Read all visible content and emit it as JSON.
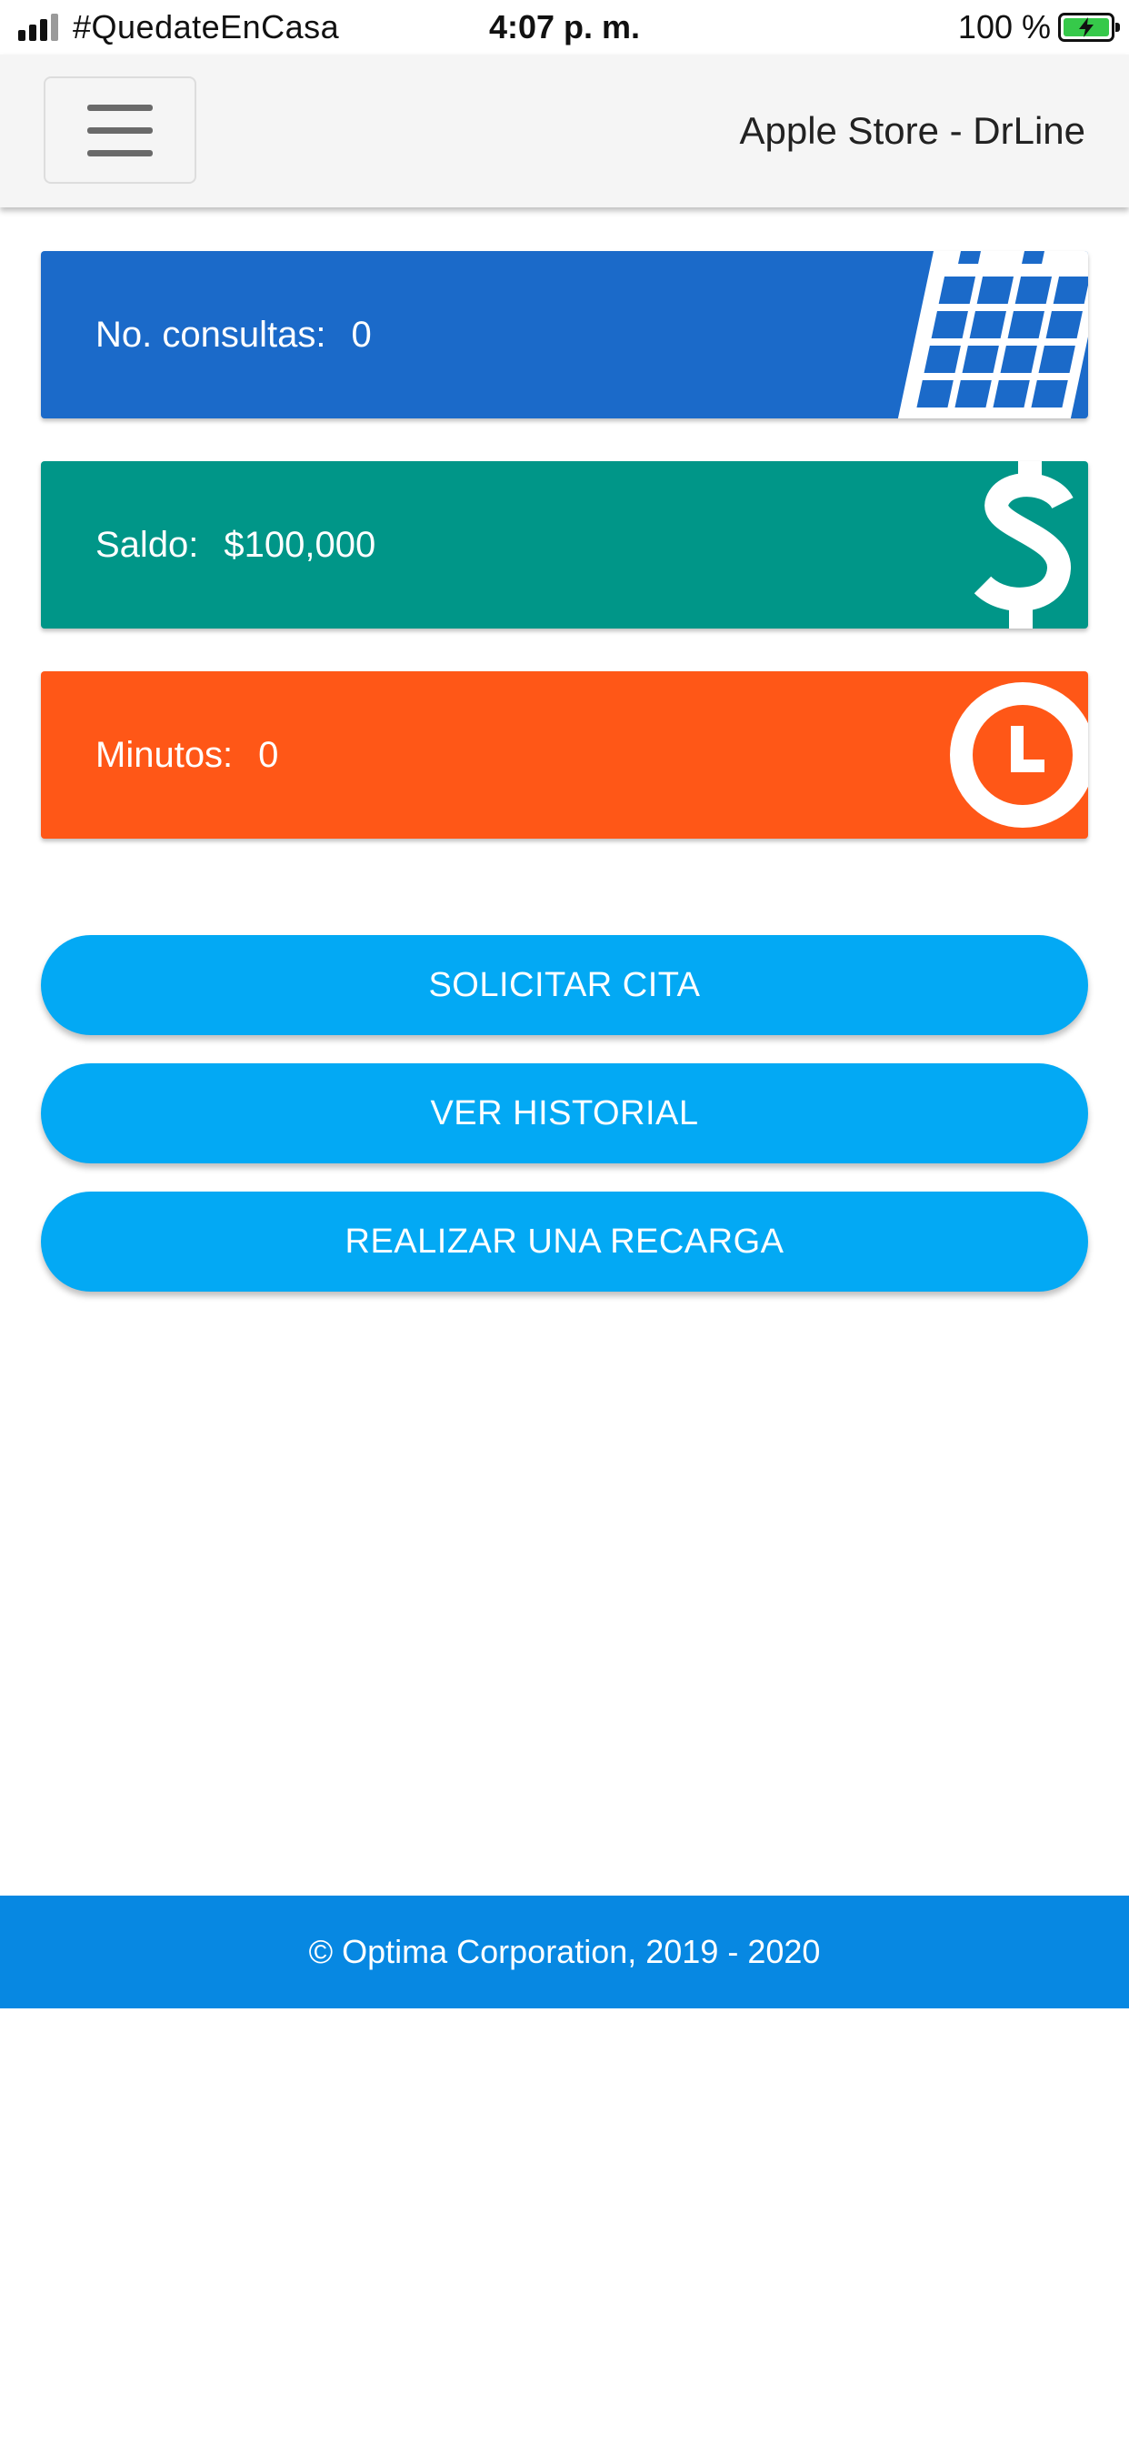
{
  "status_bar": {
    "carrier": "#QuedateEnCasa",
    "time": "4:07 p. m.",
    "battery_percent": "100 %",
    "battery_level": 1.0,
    "signal_bars": 3
  },
  "header": {
    "title": "Apple Store - DrLine",
    "menu_icon": "hamburger-menu-icon"
  },
  "cards": [
    {
      "label": "No. consultas:",
      "value": "0",
      "icon": "calendar-icon",
      "color": "#1b6ac9"
    },
    {
      "label": "Saldo:",
      "value": "$100,000",
      "icon": "dollar-icon",
      "color": "#009688"
    },
    {
      "label": "Minutos:",
      "value": "0",
      "icon": "clock-icon",
      "color": "#ff5717"
    }
  ],
  "actions": {
    "request_appointment": "SOLICITAR CITA",
    "view_history": "VER HISTORIAL",
    "recharge": "REALIZAR UNA RECARGA"
  },
  "footer": {
    "text": "© Optima Corporation, 2019 - 2020"
  },
  "colors": {
    "button": "#03a9f4",
    "footer": "#0788e2"
  }
}
